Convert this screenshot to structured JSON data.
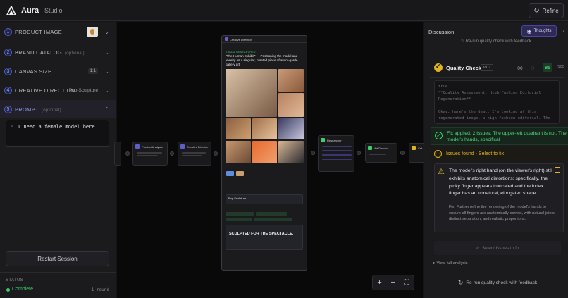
{
  "header": {
    "app_name": "Aura",
    "section": "Studio",
    "refine_label": "Refine"
  },
  "sidebar": {
    "steps": [
      {
        "num": "1",
        "label": "PRODUCT IMAGE",
        "optional": "",
        "value": ""
      },
      {
        "num": "2",
        "label": "BRAND CATALOG",
        "optional": "(optional)",
        "value": ""
      },
      {
        "num": "3",
        "label": "CANVAS SIZE",
        "optional": "",
        "value": "1:1"
      },
      {
        "num": "4",
        "label": "CREATIVE DIRECTION",
        "optional": "",
        "value": "Pop-Sculpture"
      },
      {
        "num": "5",
        "label": "PROMPT",
        "optional": "(optional)",
        "value": ""
      }
    ],
    "prompt_value": "I need a female model here",
    "prompt_marker": ">",
    "restart_label": "Restart Session",
    "status_title": "STATUS",
    "status_value": "Complete",
    "status_round": "1 round",
    "status_color": "#3ccf6c"
  },
  "canvas": {
    "nodes": [
      {
        "title": "Product Analysis"
      },
      {
        "title": "Creative Director"
      },
      {
        "title": "Researcher"
      },
      {
        "title": "Art Director"
      },
      {
        "title": "Crit"
      }
    ],
    "doc": {
      "title": "Creative Direction",
      "tag": "VISUAL RESEARCHED",
      "lead": "\"The Human Exhibit\" — Positioning the model and jewelry as a singular, curated piece of avant-garde gallery art.",
      "style_name": "Pop Sculpture",
      "headline": "SCULPTED FOR THE SPECTACLE."
    },
    "zoom_in": "+",
    "zoom_out": "−",
    "fit": "⛶"
  },
  "panel": {
    "title": "Discussion",
    "thoughts_label": "Thoughts",
    "rerun_top": "Re-run quality check with feedback",
    "quality_label": "Quality Check",
    "version": "v1.1",
    "score": "85",
    "score_of": "/100",
    "code_lines": [
      "true",
      "**Quality Assessment: High-Fashion Editorial",
      "Regeneration**",
      "",
      "Okay, here's the deal. I'm looking at this",
      "regenerated image, a high-fashion editorial. The"
    ],
    "fix_text": "Fix applied: 2 issues: The upper-left quadrant is not, The model's hands, specifical",
    "issues_text": "Issues found - Select to fix",
    "issue_main": "The model's right hand (on the viewer's right) still exhibits anatomical distortions; specifically, the pinky finger appears truncated and the index finger has an unnatural, elongated shape.",
    "issue_fix": "Fix: Further refine the rendering of the model's hands to ensure all fingers are anatomically correct, with natural joints, distinct separation, and realistic proportions.",
    "select_label": "Select issues to fix",
    "full_analysis": "▸ View full analysis",
    "rerun_bottom": "Re-run quality check with feedback"
  },
  "colors": {
    "accent": "#5b5fc7",
    "success": "#3ccf6c",
    "warning": "#e0b321"
  }
}
